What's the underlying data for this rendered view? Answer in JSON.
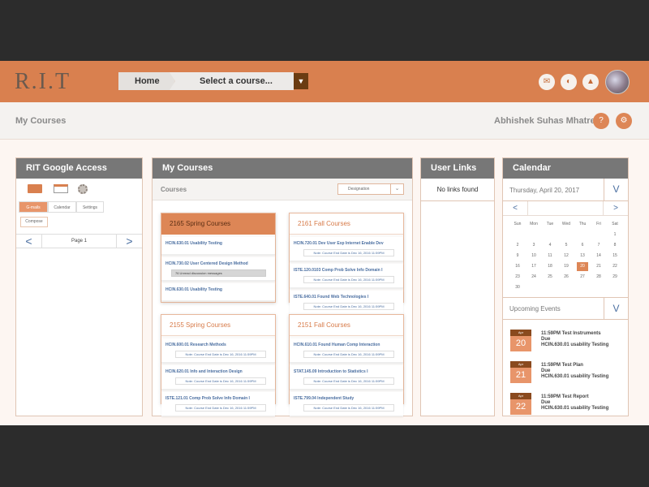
{
  "header": {
    "logo": "R.I.T",
    "crumb_home": "Home",
    "crumb_select": "Select a course...",
    "crumb_drop": "▼",
    "icons": [
      "mail-icon",
      "palette-icon",
      "notification-icon"
    ],
    "icon_glyphs": [
      "✉",
      "◐",
      "▲"
    ]
  },
  "subbar": {
    "title": "My Courses",
    "user_name": "Abhishek Suhas Mhatre",
    "help": "?",
    "settings": "⚙"
  },
  "google": {
    "title": "RIT Google Access",
    "tabs": [
      "G-mails",
      "Calendar",
      "Settings"
    ],
    "compose": "Compose",
    "prev": "<",
    "page_label": "Page 1",
    "next": ">"
  },
  "courses": {
    "title": "My Courses",
    "sub_label": "Courses",
    "designation": "Designation",
    "designation_caret": "⌄",
    "groups": [
      {
        "name": "2165 Spring Courses",
        "items": [
          {
            "title": "HCIN.630.01 Usability Testing",
            "note": ""
          },
          {
            "title": "HCIN.730.02 User Centered Design Method",
            "note": "76 Unread discussion messages"
          },
          {
            "title": "HCIN.630.01 Usability Testing",
            "note": ""
          }
        ]
      },
      {
        "name": "2161 Fall Courses",
        "items": [
          {
            "title": "HCIN.720.01 Dev User Exp Internet Enable Dev",
            "note": "Note: Course End Date is Dec 16, 2016 11:59PM"
          },
          {
            "title": "ISTE.120.0103 Comp Prob Solve Info Domain I",
            "note": "Note: Course End Date is Dec 16, 2016 11:59PM"
          },
          {
            "title": "ISTE.640.01 Found Web Technologies I",
            "note": "Note: Course End Date is Dec 16, 2016 11:59PM"
          }
        ]
      },
      {
        "name": "2155 Spring Courses",
        "items": [
          {
            "title": "HCIN.600.01 Research Methods",
            "note": "Note: Course End Date is Dec 16, 2016 11:59PM"
          },
          {
            "title": "HCIN.620.01 Info and Interaction Design",
            "note": "Note: Course End Date is Dec 16, 2016 11:59PM"
          },
          {
            "title": "ISTE.121.01 Comp Prob Solve Info Domain I",
            "note": "Note: Course End Date is Dec 16, 2016 11:59PM"
          }
        ]
      },
      {
        "name": "2151 Fall Courses",
        "items": [
          {
            "title": "HCIN.610.01 Found Human Comp Interaction",
            "note": "Note: Course End Date is Dec 16, 2016 11:59PM"
          },
          {
            "title": "STAT.145.09 Introduction to Statistics I",
            "note": "Note: Course End Date is Dec 16, 2016 11:59PM"
          },
          {
            "title": "ISTE.799.04 Independent Study",
            "note": "Note: Course End Date is Dec 16, 2016 11:59PM"
          }
        ]
      }
    ]
  },
  "user_links": {
    "title": "User Links",
    "empty": "No links found"
  },
  "calendar": {
    "title": "Calendar",
    "date_label": "Thursday, April 20, 2017",
    "expand": "V",
    "prev": "<",
    "next": ">",
    "weekdays": [
      "Sun",
      "Mon",
      "Tue",
      "Wed",
      "Thu",
      "Fri",
      "Sat"
    ],
    "today": "20",
    "weeks": [
      [
        "",
        "",
        "",
        "",
        "",
        "",
        "1"
      ],
      [
        "2",
        "3",
        "4",
        "5",
        "6",
        "7",
        "8"
      ],
      [
        "9",
        "10",
        "11",
        "12",
        "13",
        "14",
        "15"
      ],
      [
        "16",
        "17",
        "18",
        "19",
        "20",
        "21",
        "22"
      ],
      [
        "23",
        "24",
        "25",
        "26",
        "27",
        "28",
        "29"
      ],
      [
        "30",
        "",
        "",
        "",
        "",
        "",
        ""
      ]
    ],
    "upcoming_title": "Upcoming Events",
    "upcoming_expand": "V",
    "events": [
      {
        "month": "Apr",
        "day": "20",
        "time_title": "11:59PM Test Instruments",
        "due": "Due",
        "course": "HCIN.630.01 usability Testing"
      },
      {
        "month": "Apr",
        "day": "21",
        "time_title": "11:59PM Test Plan",
        "due": "Due",
        "course": "HCIN.630.01 usability Testing"
      },
      {
        "month": "Apr",
        "day": "22",
        "time_title": "11:59PM Test Report",
        "due": "Due",
        "course": "HCIN.630.01 usability Testing"
      }
    ]
  }
}
